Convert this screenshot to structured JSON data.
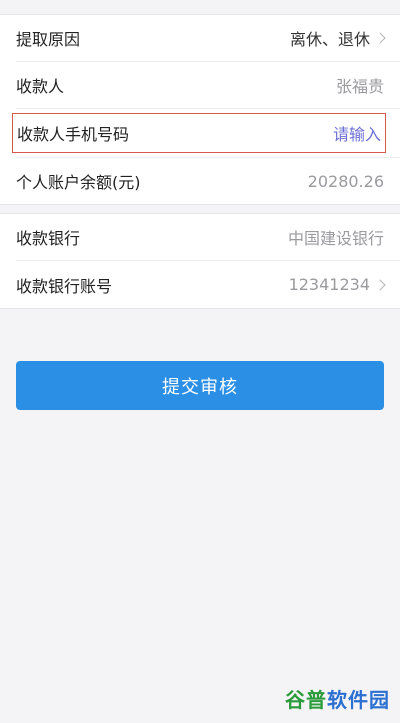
{
  "form": {
    "group1": [
      {
        "label": "提取原因",
        "value": "离休、退休",
        "chevron": true,
        "style": "dark"
      },
      {
        "label": "收款人",
        "value": "张福贵",
        "chevron": false,
        "style": "muted"
      },
      {
        "label": "收款人手机号码",
        "value": "请输入",
        "chevron": false,
        "style": "placeholder"
      },
      {
        "label": "个人账户余额(元)",
        "value": "20280.26",
        "chevron": false,
        "style": "muted"
      }
    ],
    "group2": [
      {
        "label": "收款银行",
        "value": "中国建设银行",
        "chevron": false,
        "style": "muted"
      },
      {
        "label": "收款银行账号",
        "value": "12341234",
        "chevron": true,
        "style": "muted"
      }
    ]
  },
  "submit_label": "提交审核",
  "watermark": {
    "part1": "谷普",
    "part2": "软件园"
  },
  "colors": {
    "primary": "#2b8fe6",
    "placeholder": "#6b6fd6",
    "highlight_border": "#d45a4a",
    "background": "#f4f4f6"
  }
}
